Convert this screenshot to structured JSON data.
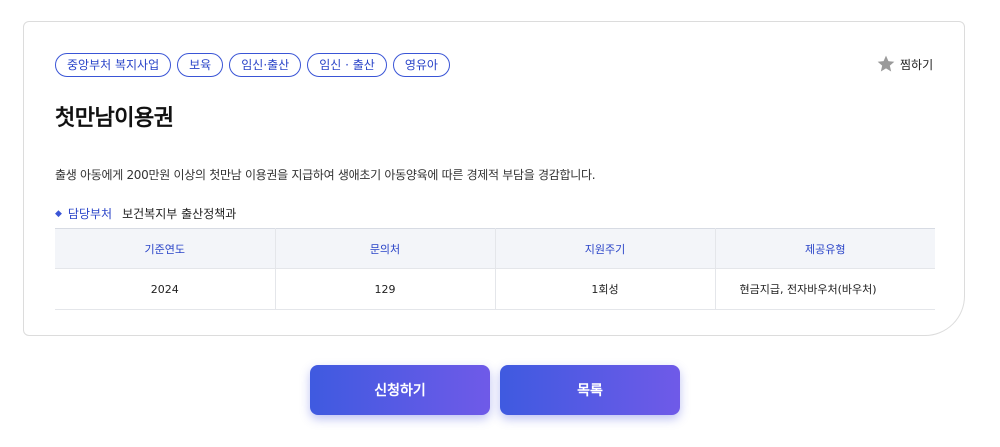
{
  "tags": [
    "중앙부처 복지사업",
    "보육",
    "임신·출산",
    "임신 · 출산",
    "영유아"
  ],
  "favorite": {
    "label": "찜하기",
    "icon": "star-icon"
  },
  "title": "첫만남이용권",
  "description": "출생 아동에게 200만원 이상의 첫만남 이용권을 지급하여 생애초기 아동양육에 따른 경제적 부담을 경감합니다.",
  "department": {
    "label": "담당부처",
    "value": "보건복지부 출산정책과"
  },
  "table": {
    "headers": [
      "기준연도",
      "문의처",
      "지원주기",
      "제공유형"
    ],
    "row": [
      "2024",
      "129",
      "1회성",
      "현금지급, 전자바우처(바우처)"
    ]
  },
  "buttons": {
    "apply": "신청하기",
    "list": "목록"
  },
  "colors": {
    "accent": "#3a55d6",
    "button_start": "#3f5ae0",
    "button_end": "#6f5ae8",
    "star": "#9a9a9a"
  }
}
